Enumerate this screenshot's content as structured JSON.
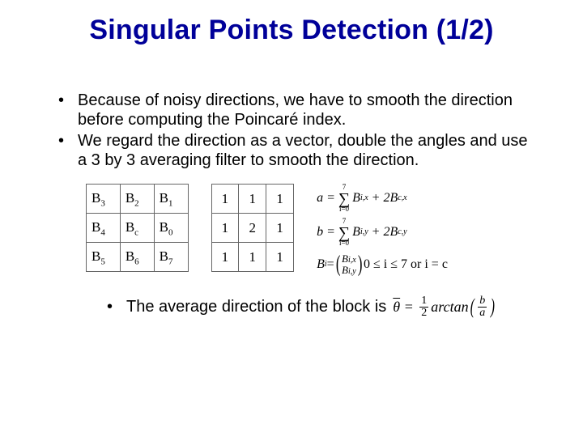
{
  "title": "Singular Points Detection (1/2)",
  "bullets": [
    "Because of noisy directions, we have to smooth the direction before computing the Poincaré index.",
    "We regard the direction as a vector, double the angles and use a 3 by 3 averaging filter to smooth the direction."
  ],
  "tableB": {
    "r0": {
      "c0": {
        "b": "B",
        "s": "3"
      },
      "c1": {
        "b": "B",
        "s": "2"
      },
      "c2": {
        "b": "B",
        "s": "1"
      }
    },
    "r1": {
      "c0": {
        "b": "B",
        "s": "4"
      },
      "c1": {
        "b": "B",
        "s": "c"
      },
      "c2": {
        "b": "B",
        "s": "0"
      }
    },
    "r2": {
      "c0": {
        "b": "B",
        "s": "5"
      },
      "c1": {
        "b": "B",
        "s": "6"
      },
      "c2": {
        "b": "B",
        "s": "7"
      }
    }
  },
  "kernel": {
    "r0": {
      "c0": "1",
      "c1": "1",
      "c2": "1"
    },
    "r1": {
      "c0": "1",
      "c1": "2",
      "c2": "1"
    },
    "r2": {
      "c0": "1",
      "c1": "1",
      "c2": "1"
    }
  },
  "eq": {
    "a_lhs": "a =",
    "a_sum_top": "7",
    "a_sum_bot": "i=0",
    "a_rhs1": "B",
    "a_rhs1_sub": "i,x",
    "a_rhs2": "+ 2B",
    "a_rhs2_sub": "c,x",
    "b_lhs": "b =",
    "b_sum_top": "7",
    "b_sum_bot": "i=0",
    "b_rhs1": "B",
    "b_rhs1_sub": "i,y",
    "b_rhs2": "+ 2B",
    "b_rhs2_sub": "c,y",
    "c_lhs": "B",
    "c_lhs_sub": "i",
    "c_eq": " = ",
    "c_top": "B",
    "c_top_sub": "i,x",
    "c_bot": "B",
    "c_bot_sub": "i,y",
    "c_cond": "0 ≤ i ≤ 7 or i = c"
  },
  "bottom": {
    "text": "The average direction of the block is",
    "theta": "θ",
    "half_n": "1",
    "half_d": "2",
    "fn": "arctan",
    "frac_n": "b",
    "frac_d": "a"
  }
}
